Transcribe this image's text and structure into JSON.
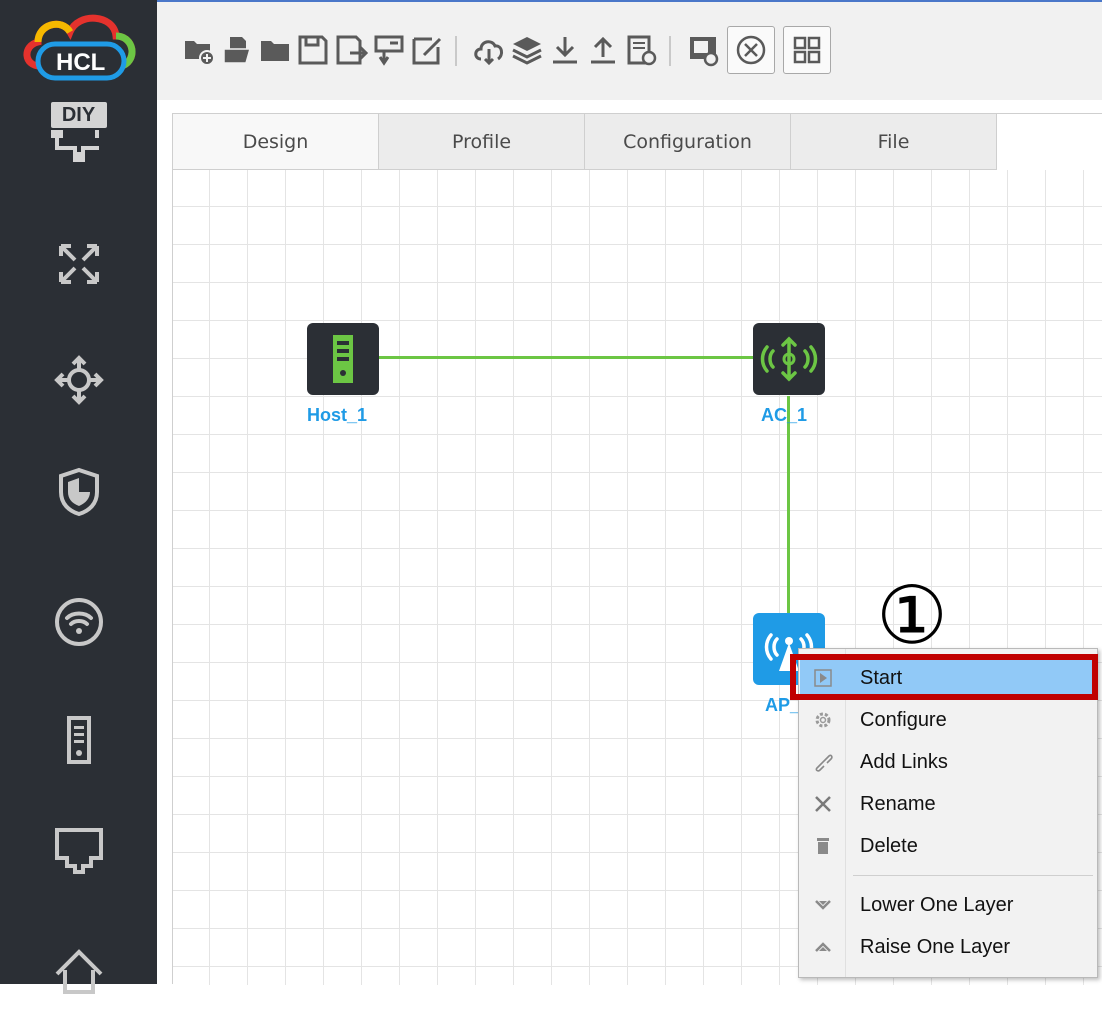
{
  "app": {
    "logo_text": "HCL",
    "brand_colors": {
      "red": "#e5322d",
      "yellow": "#f5b800",
      "green": "#6cc644",
      "blue": "#1f9be6"
    }
  },
  "sidebar": {
    "items": [
      {
        "name": "diy",
        "icon": "diy-icon",
        "text": "DIY"
      },
      {
        "name": "switch",
        "icon": "switch-icon"
      },
      {
        "name": "router",
        "icon": "router-icon"
      },
      {
        "name": "firewall",
        "icon": "shield-icon"
      },
      {
        "name": "wireless",
        "icon": "wifi-icon"
      },
      {
        "name": "host",
        "icon": "host-icon"
      },
      {
        "name": "interface",
        "icon": "port-icon"
      },
      {
        "name": "other",
        "icon": "home-icon"
      }
    ]
  },
  "toolbar": {
    "buttons": [
      "new-project-icon",
      "open-file-icon",
      "open-folder-icon",
      "save-icon",
      "save-as-icon",
      "export-icon",
      "edit-icon",
      "cloud-icon",
      "layers-icon",
      "download-icon",
      "upload-icon",
      "history-icon",
      "screenshot-icon",
      "topology-view-icon",
      "grid-view-icon"
    ]
  },
  "tabs": [
    {
      "label": "Design",
      "active": true
    },
    {
      "label": "Profile",
      "active": false
    },
    {
      "label": "Configuration",
      "active": false
    },
    {
      "label": "File",
      "active": false
    }
  ],
  "devices": [
    {
      "id": "host1",
      "label": "Host_1",
      "type": "host",
      "color": "#2b2f35"
    },
    {
      "id": "ac1",
      "label": "AC_1",
      "type": "access-controller",
      "color": "#2b2f35"
    },
    {
      "id": "ap1",
      "label": "AP_",
      "type": "access-point",
      "color": "#1f9be6"
    }
  ],
  "annotation": {
    "marker": "①",
    "highlight_color": "#c00000"
  },
  "context_menu": {
    "items": [
      {
        "label": "Start",
        "icon": "play-icon",
        "highlighted": true
      },
      {
        "label": "Configure",
        "icon": "gear-icon"
      },
      {
        "label": "Add Links",
        "icon": "link-icon"
      },
      {
        "label": "Rename",
        "icon": "rename-icon"
      },
      {
        "label": "Delete",
        "icon": "trash-icon"
      },
      {
        "label": "Lower One Layer",
        "icon": "chevron-down-icon"
      },
      {
        "label": "Raise One Layer",
        "icon": "chevron-up-icon"
      }
    ],
    "highlight_color": "#91c9f7"
  }
}
